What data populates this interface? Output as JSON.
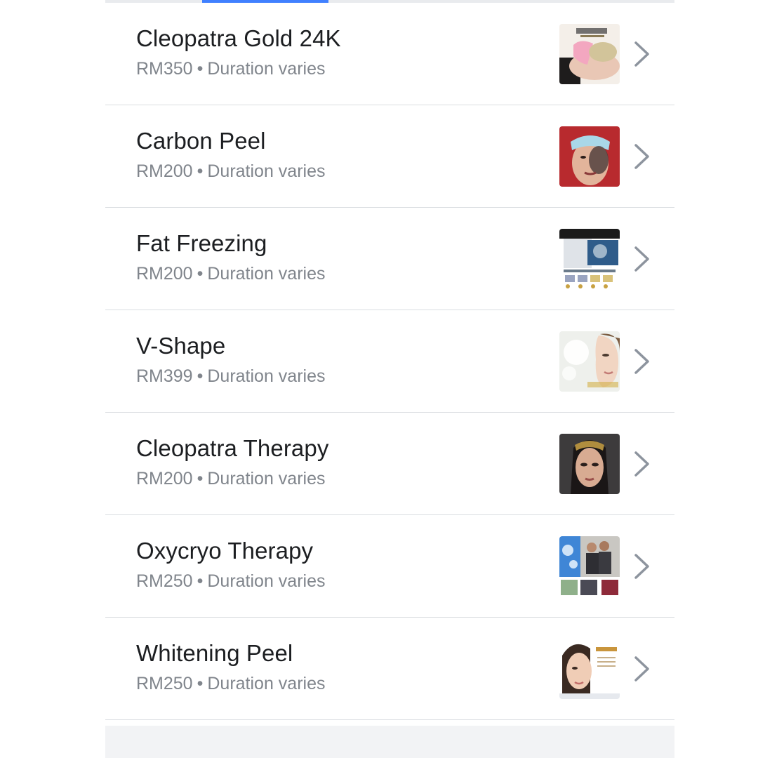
{
  "tabs": {
    "active_color": "#4080ff"
  },
  "services": [
    {
      "name": "Cleopatra Gold 24K",
      "price": "RM350",
      "separator": "•",
      "duration": "Duration varies",
      "thumbnail_icon": "cleopatra-gold-photo"
    },
    {
      "name": "Carbon Peel",
      "price": "RM200",
      "separator": "•",
      "duration": "Duration varies",
      "thumbnail_icon": "carbon-peel-photo"
    },
    {
      "name": "Fat Freezing",
      "price": "RM200",
      "separator": "•",
      "duration": "Duration varies",
      "thumbnail_icon": "fat-freezing-photo"
    },
    {
      "name": "V-Shape",
      "price": "RM399",
      "separator": "•",
      "duration": "Duration varies",
      "thumbnail_icon": "v-shape-photo"
    },
    {
      "name": "Cleopatra Therapy",
      "price": "RM200",
      "separator": "•",
      "duration": "Duration varies",
      "thumbnail_icon": "cleopatra-therapy-photo"
    },
    {
      "name": "Oxycryo Therapy",
      "price": "RM250",
      "separator": "•",
      "duration": "Duration varies",
      "thumbnail_icon": "oxycryo-therapy-photo"
    },
    {
      "name": "Whitening Peel",
      "price": "RM250",
      "separator": "•",
      "duration": "Duration varies",
      "thumbnail_icon": "whitening-peel-photo"
    }
  ],
  "colors": {
    "title_text": "#1c1e21",
    "meta_text": "#80858c",
    "divider": "#dadde1",
    "chevron": "#8d949e",
    "footer_band": "#f2f3f5"
  }
}
